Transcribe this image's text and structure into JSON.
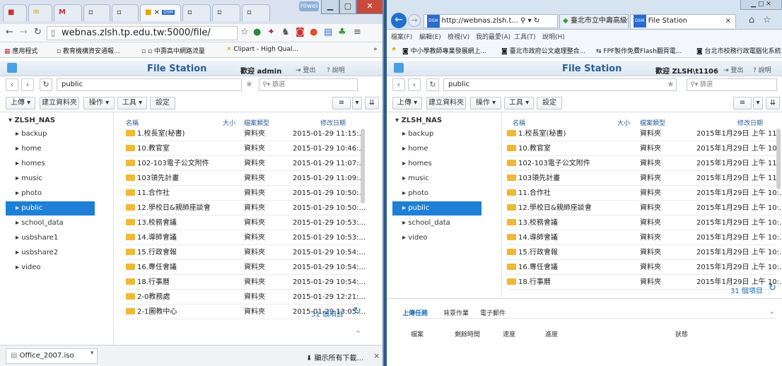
{
  "chrome": {
    "tabs": [
      "",
      "",
      "M",
      "",
      "",
      "",
      "",
      ""
    ],
    "active_tab_label": "×",
    "user_badge": "Hiwei",
    "url": "webnas.zlsh.tp.edu.tw:5000/file/",
    "bookmarks": [
      "應用程式",
      "教育機構資安通報...",
      "中壽高中網路流量",
      "Clipart - High Qual..."
    ],
    "bookmarks_more": "»",
    "download_file": "Office_2007.iso",
    "show_all_downloads": "顯示所有下載...",
    "close_x": "×"
  },
  "fs_left": {
    "title": "File Station",
    "welcome": "歡迎 admin",
    "logout": "登出",
    "help": "說明",
    "path": "public",
    "search_placeholder": "篩選",
    "toolbar": {
      "upload": "上傳",
      "new_folder": "建立資料夾",
      "action": "操作",
      "tools": "工具",
      "settings": "設定"
    },
    "tree_root": "ZLSH_NAS",
    "tree": [
      "backup",
      "home",
      "homes",
      "music",
      "photo",
      "public",
      "school_data",
      "usbshare1",
      "usbshare2",
      "video"
    ],
    "selected": "public",
    "columns": {
      "name": "名稱",
      "size": "大小",
      "type": "檔案類型",
      "modified": "修改日期"
    },
    "rows": [
      {
        "name": "1.校長室(秘書)",
        "type": "資料夾",
        "date": "2015-01-29 11:15:..."
      },
      {
        "name": "10.教官室",
        "type": "資料夾",
        "date": "2015-01-29 10:46:..."
      },
      {
        "name": "102-103電子公文附件",
        "type": "資料夾",
        "date": "2015-01-29 11:07:..."
      },
      {
        "name": "103領先計畫",
        "type": "資料夾",
        "date": "2015-01-29 11:09:..."
      },
      {
        "name": "11.合作社",
        "type": "資料夾",
        "date": "2015-01-29 10:50:..."
      },
      {
        "name": "12.學校日&親師座談會",
        "type": "資料夾",
        "date": "2015-01-29 10:50:..."
      },
      {
        "name": "13.校務會議",
        "type": "資料夾",
        "date": "2015-01-29 10:53:..."
      },
      {
        "name": "14.導師會議",
        "type": "資料夾",
        "date": "2015-01-29 10:53:..."
      },
      {
        "name": "15.行政會報",
        "type": "資料夾",
        "date": "2015-01-29 10:54:..."
      },
      {
        "name": "16.專任會議",
        "type": "資料夾",
        "date": "2015-01-29 10:54:..."
      },
      {
        "name": "18.行事曆",
        "type": "資料夾",
        "date": "2015-01-29 10:54:..."
      },
      {
        "name": "2-0教務處",
        "type": "資料夾",
        "date": "2015-01-29 12:21:..."
      },
      {
        "name": "2-1圖教中心",
        "type": "資料夾",
        "date": "2015-01-29 13:05:..."
      }
    ],
    "count": "31 個項目"
  },
  "ie": {
    "url": "http://webnas.zlsh.t...",
    "tab1": "臺北市立中壽高級中學",
    "tab2": "File Station",
    "tab_close": "×",
    "menu": [
      "檔案(F)",
      "編輯(E)",
      "檢視(V)",
      "我的最愛(A)",
      "工具(T)",
      "說明(H)"
    ],
    "favorites": [
      "中小學教師專業發展網上...",
      "臺北市政府公文處理整合...",
      "FPF製作免費Flash翻頁電...",
      "台北市校務行政電腦化系統"
    ],
    "brand": "DSM"
  },
  "fs_right": {
    "title": "File Station",
    "welcome": "歡迎 ZLSH\\t1106",
    "logout": "登出",
    "help": "說明",
    "path": "public",
    "search_placeholder": "篩選",
    "toolbar": {
      "upload": "上傳",
      "new_folder": "建立資料夾",
      "action": "操作",
      "tools": "工具",
      "settings": "設定"
    },
    "tree_root": "ZLSH_NAS",
    "tree": [
      "backup",
      "home",
      "homes",
      "music",
      "photo",
      "public",
      "school_data",
      "video"
    ],
    "selected": "public",
    "columns": {
      "name": "名稱",
      "size": "大小",
      "type": "檔案類型",
      "modified": "修改日期"
    },
    "rows": [
      {
        "name": "1.校長室(秘書)",
        "type": "資料夾",
        "date": "2015年1月29日 上午 11:..."
      },
      {
        "name": "10.教官室",
        "type": "資料夾",
        "date": "2015年1月29日 上午 10:..."
      },
      {
        "name": "102-103電子公文附件",
        "type": "資料夾",
        "date": "2015年1月29日 上午 11:..."
      },
      {
        "name": "103領先計畫",
        "type": "資料夾",
        "date": "2015年1月29日 上午 11:..."
      },
      {
        "name": "11.合作社",
        "type": "資料夾",
        "date": "2015年1月29日 上午 10:..."
      },
      {
        "name": "12.學校日&親師座談會",
        "type": "資料夾",
        "date": "2015年1月29日 上午 10:..."
      },
      {
        "name": "13.校務會議",
        "type": "資料夾",
        "date": "2015年1月29日 上午 10:..."
      },
      {
        "name": "14.導師會議",
        "type": "資料夾",
        "date": "2015年1月29日 上午 10:..."
      },
      {
        "name": "15.行政會報",
        "type": "資料夾",
        "date": "2015年1月29日 上午 10:..."
      },
      {
        "name": "16.專任會議",
        "type": "資料夾",
        "date": "2015年1月29日 上午 10:..."
      },
      {
        "name": "18.行事曆",
        "type": "資料夾",
        "date": "2015年1月29日 上午 10:..."
      }
    ],
    "count": "31 個項目",
    "task_tabs": [
      "上傳任務",
      "背景作業",
      "電子郵件"
    ],
    "task_columns": [
      "檔案",
      "剩餘時間",
      "速度",
      "進度",
      "狀態"
    ]
  }
}
